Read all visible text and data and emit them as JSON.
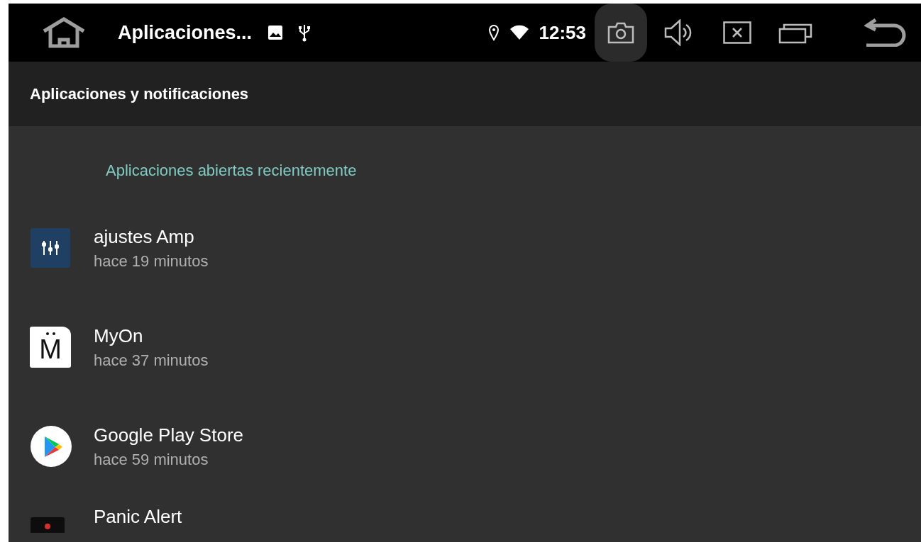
{
  "status_bar": {
    "title": "Aplicaciones...",
    "notification_icons": [
      {
        "kind": "image"
      },
      {
        "kind": "usb"
      }
    ],
    "system_icons": [
      {
        "kind": "location"
      },
      {
        "kind": "wifi"
      }
    ],
    "time": "12:53",
    "buttons": [
      {
        "kind": "camera",
        "pressed": true
      },
      {
        "kind": "volume",
        "pressed": false
      },
      {
        "kind": "close-app",
        "pressed": false
      },
      {
        "kind": "recents",
        "pressed": false
      }
    ]
  },
  "header": {
    "title": "Aplicaciones y notificaciones"
  },
  "section": {
    "title": "Aplicaciones abiertas recientemente"
  },
  "apps": [
    {
      "kind": "equalizer",
      "name": "ajustes Amp",
      "subtitle": "hace 19 minutos"
    },
    {
      "kind": "letter",
      "letter": "M",
      "name": "MyOn",
      "subtitle": "hace 37 minutos"
    },
    {
      "kind": "play",
      "name": "Google Play Store",
      "subtitle": "hace 59 minutos"
    },
    {
      "kind": "alert",
      "name": "Panic Alert"
    }
  ]
}
